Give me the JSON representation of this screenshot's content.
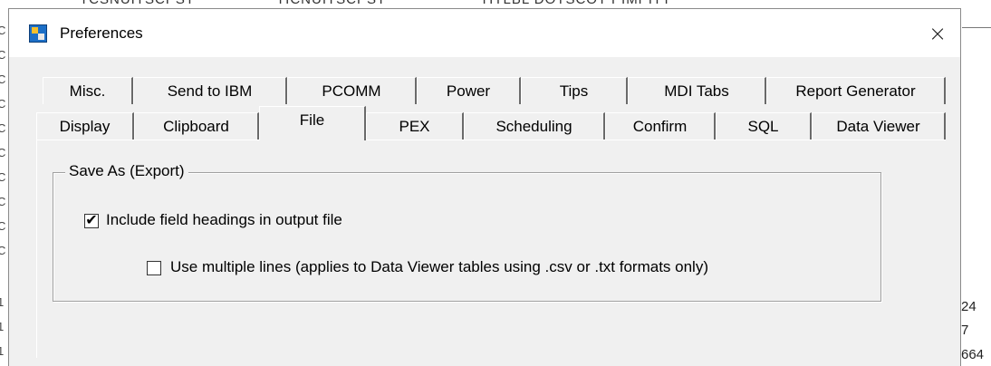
{
  "window": {
    "title": "Preferences",
    "close_glyph": "×",
    "icon": "preferences-app-icon"
  },
  "background": {
    "top_fragments": [
      "TCSNUITSCPST",
      "TICNUITSCPST",
      "TITLBL DOTSCOT PIMPITT"
    ],
    "left_digits": [
      "C",
      "C",
      "C",
      "C",
      "C",
      "C",
      "C",
      "C",
      "C",
      "C",
      "1",
      "1",
      "1"
    ],
    "right_values": [
      "24",
      "7",
      "664"
    ]
  },
  "tabs": {
    "row1": [
      "Misc.",
      "Send to IBM",
      "PCOMM",
      "Power",
      "Tips",
      "MDI Tabs",
      "Report Generator"
    ],
    "row2": [
      "Display",
      "Clipboard",
      "File",
      "PEX",
      "Scheduling",
      "Confirm",
      "SQL",
      "Data Viewer"
    ],
    "selected": "File"
  },
  "file_panel": {
    "group_title": "Save As (Export)",
    "options": [
      {
        "label": "Include field headings in output file",
        "checked": true
      },
      {
        "label": "Use multiple lines (applies to Data Viewer tables using .csv or .txt formats only)",
        "checked": false
      }
    ]
  },
  "colors": {
    "dialog_bg": "#f0f0f0",
    "titlebar_bg": "#ffffff",
    "border": "#8a8a8a"
  }
}
